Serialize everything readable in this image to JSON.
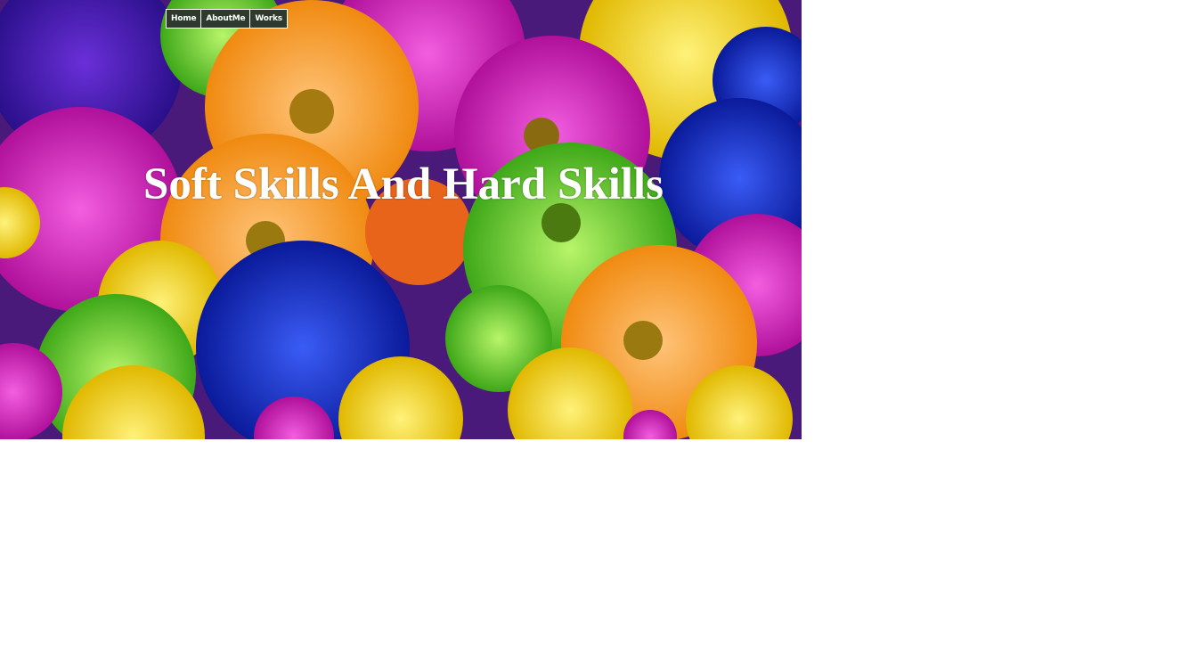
{
  "nav": {
    "items": [
      {
        "label": "Home"
      },
      {
        "label": "AboutMe"
      },
      {
        "label": "Works"
      }
    ]
  },
  "hero": {
    "title": "Soft Skills And Hard Skills",
    "background_image": "colorful-daisy-flowers"
  },
  "colors": {
    "nav_bg": "#2e3a2e",
    "nav_text": "#ffffff",
    "title_text": "#ffffff",
    "page_bg": "#ffffff"
  }
}
